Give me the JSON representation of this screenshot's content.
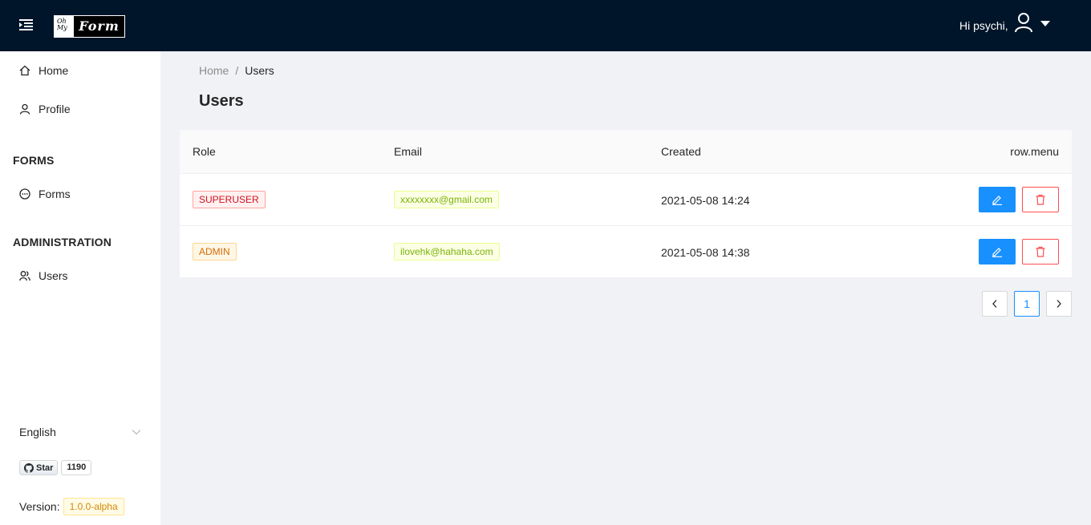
{
  "header": {
    "greeting": "Hi psychi,",
    "logo_small": "Oh My",
    "logo_main": "Form"
  },
  "sidebar": {
    "items": [
      {
        "label": "Home",
        "icon": "home-icon"
      },
      {
        "label": "Profile",
        "icon": "user-icon"
      }
    ],
    "groups": [
      {
        "title": "FORMS",
        "items": [
          {
            "label": "Forms",
            "icon": "message-icon"
          }
        ]
      },
      {
        "title": "ADMINISTRATION",
        "items": [
          {
            "label": "Users",
            "icon": "users-icon"
          }
        ]
      }
    ],
    "language": "English",
    "github": {
      "star_label": "Star",
      "count": "1190"
    },
    "version_label": "Version:",
    "version": "1.0.0-alpha"
  },
  "breadcrumb": {
    "home": "Home",
    "separator": "/",
    "current": "Users"
  },
  "page": {
    "title": "Users"
  },
  "table": {
    "columns": [
      "Role",
      "Email",
      "Created",
      "row.menu"
    ],
    "rows": [
      {
        "role": "SUPERUSER",
        "email": "xxxxxxxx@gmail.com",
        "created": "2021-05-08 14:24"
      },
      {
        "role": "ADMIN",
        "email": "ilovehk@hahaha.com",
        "created": "2021-05-08 14:38"
      }
    ]
  },
  "pagination": {
    "current": "1"
  },
  "colors": {
    "header_bg": "#001529",
    "primary": "#1890ff",
    "danger": "#ff4d4f"
  }
}
